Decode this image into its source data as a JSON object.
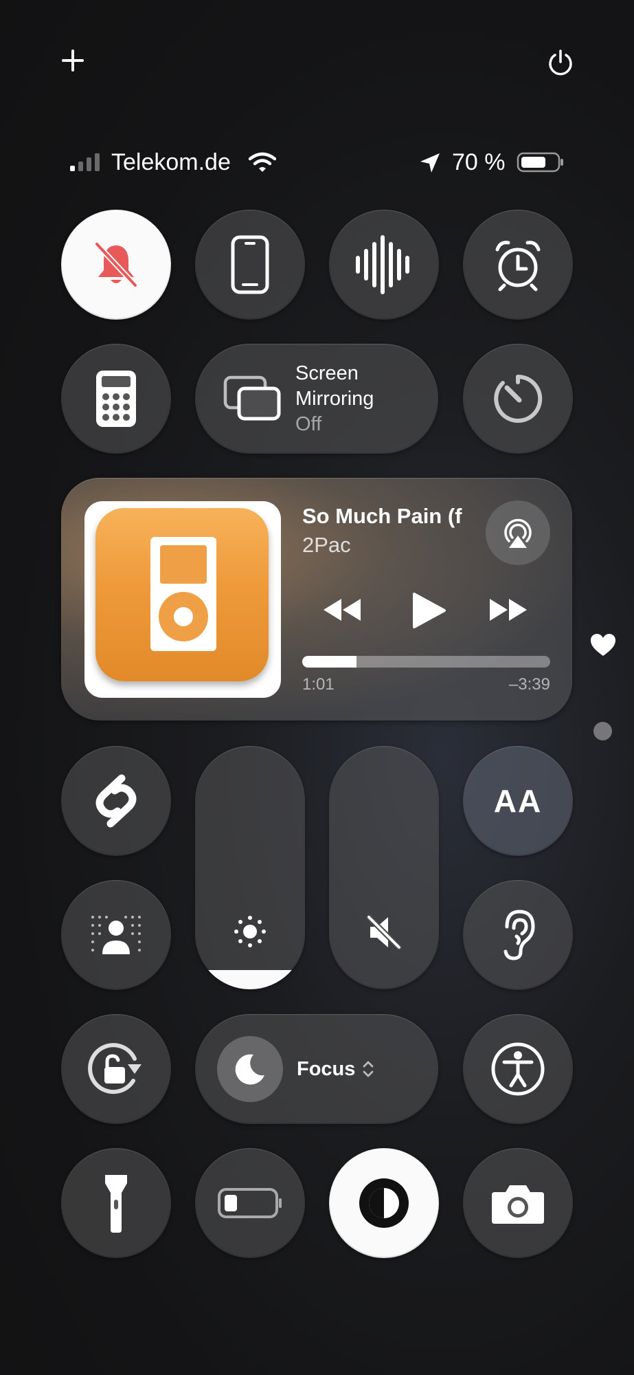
{
  "top_bar": {
    "add_icon": "plus-icon",
    "power_icon": "power-icon"
  },
  "status_bar": {
    "carrier": "Telekom.de",
    "battery_percent": "70 %",
    "signal_bars_filled": 1,
    "battery_level": 0.7
  },
  "controls": {
    "silent_mode_icon": "bell-slash-icon",
    "screen_icon": "iphone-icon",
    "sound_recognition_icon": "waveform-icon",
    "alarm_icon": "alarm-icon",
    "calculator_icon": "calculator-icon",
    "screen_mirroring": {
      "title_line1": "Screen",
      "title_line2": "Mirroring",
      "status": "Off"
    },
    "timer_icon": "timer-icon"
  },
  "now_playing": {
    "title": "So Much Pain (f",
    "artist": "2Pac",
    "elapsed": "1:01",
    "remaining": "–3:39",
    "progress": 0.22,
    "airplay_icon": "airplay-icon"
  },
  "side_indicators": {
    "heart_icon": "heart-icon",
    "page_dot": "page-dot"
  },
  "sliders": {
    "brightness_level": 0.08,
    "volume_level": 0.0
  },
  "text_size": {
    "label": "AA"
  },
  "focus": {
    "label": "Focus"
  },
  "colors": {
    "accent_red": "#e8595a",
    "tile_bg": "#565658",
    "white": "#fafafa"
  }
}
